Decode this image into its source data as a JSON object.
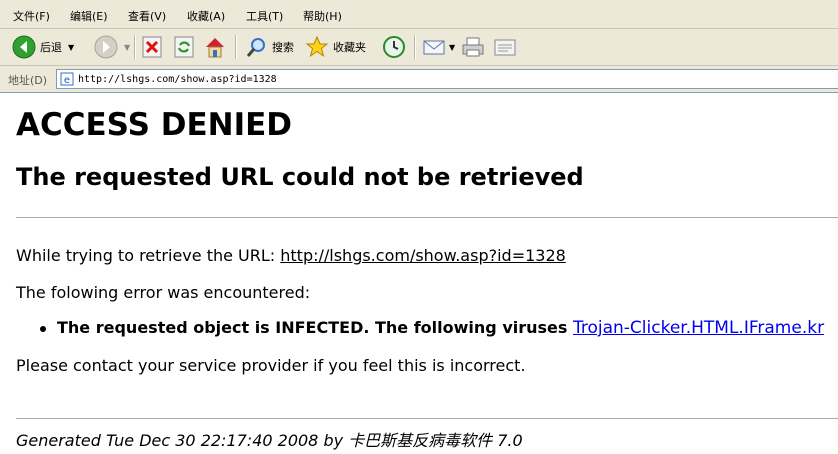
{
  "menu": {
    "file": "文件(F)",
    "edit": "编辑(E)",
    "view": "查看(V)",
    "favorites": "收藏(A)",
    "tools": "工具(T)",
    "help": "帮助(H)"
  },
  "toolbar": {
    "back_label": "后退",
    "search_label": "搜索",
    "favorites_label": "收藏夹"
  },
  "address_bar": {
    "label": "地址(D)",
    "url": "http://lshgs.com/show.asp?id=1328"
  },
  "page": {
    "title": "ACCESS DENIED",
    "subtitle": "The requested URL could not be retrieved",
    "retrieve_prefix": "While trying to retrieve the URL: ",
    "retrieve_url": "http://lshgs.com/show.asp?id=1328",
    "error_intro": "The folowing error was encountered:",
    "error_text": "The requested object is INFECTED. The following viruses ",
    "virus_name": "Trojan-Clicker.HTML.IFrame.kr",
    "contact": "Please contact your service provider if you feel this is incorrect.",
    "footer": "Generated Tue Dec 30 22:17:40 2008 by 卡巴斯基反病毒软件 7.0"
  },
  "colors": {
    "chrome": "#ece9d8",
    "link": "#0000ee"
  }
}
